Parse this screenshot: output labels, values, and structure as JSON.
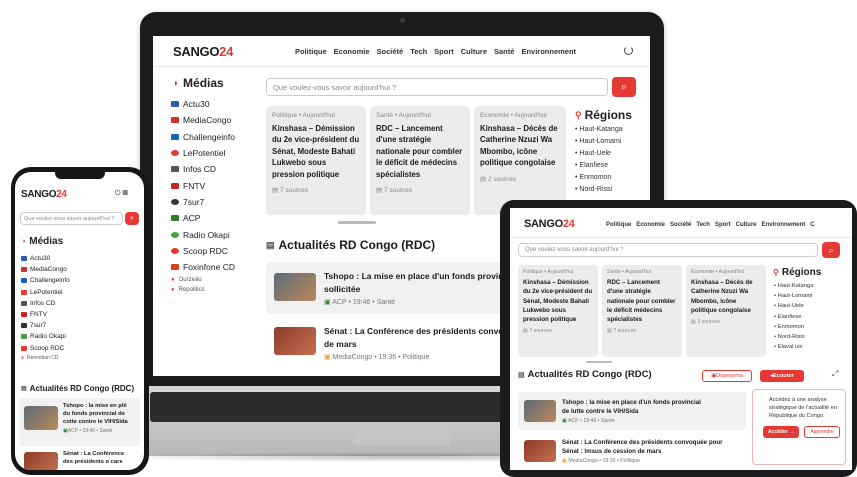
{
  "brand": {
    "name": "SANGO",
    "number": "24",
    "accent": "#e53935"
  },
  "nav": [
    "Politique",
    "Economie",
    "Société",
    "Tech",
    "Sport",
    "Culture",
    "Santé",
    "Environnement"
  ],
  "tablet_nav": [
    "Politique",
    "Economie",
    "Société",
    "Tech",
    "Sport",
    "Culture",
    "Environnement",
    "C"
  ],
  "search": {
    "placeholder": "Que voulez-vous savoir aujourd'hui ?",
    "placeholder_short": "Que voulez-vous savoir aujourd'hui ?"
  },
  "medias": {
    "title": "Médias",
    "items": [
      "Actu30",
      "MediaCongo",
      "Challengeinfo",
      "LePotentiel",
      "Infos CD",
      "FNTV",
      "7sur7",
      "ACP",
      "Radio Okapi",
      "Scoop RDC",
      "Foxinfone CD"
    ],
    "more": [
      "Ourzeäo",
      "Repolitics"
    ],
    "phone_items": [
      "Actu30",
      "MediaCongo",
      "Challengeinfo",
      "LePotentiel",
      "Infos CD",
      "FNTV",
      "7sur7",
      "Radio Okapi",
      "Scoop RDC"
    ],
    "phone_more": "Rennekan CD"
  },
  "cards": [
    {
      "tag": "Politique • Aujourd'hui",
      "title": "Kinshasa – Démission du 2e vice-président du Sénat, Modeste Bahati Lukwebo sous pression politique",
      "sources": "7 sources"
    },
    {
      "tag": "Santé • Aujourd'hui",
      "title": "RDC – Lancement d'une stratégie nationale pour combler le déficit de médecins spécialistes",
      "sources": "7 sources"
    },
    {
      "tag": "Economie • Aujourd'hui",
      "title": "Kinshasa – Décès de Catherine Nzuzi Wa Mbombo, icône politique congolaise",
      "sources": "2 sources"
    }
  ],
  "tablet_cards": [
    {
      "tag": "Politique • Aujourd'hui",
      "title": "Kinshasa – Démission du 2e vice-président du Sénat, Modeste Bahati Lukwebo sous pression politique",
      "sources": "7 sources"
    },
    {
      "tag": "Santé • Aujourd'hui",
      "title": "RDC – Lancement d'une stratégie nationale pour combler le déficit médecins spécialistes",
      "sources": "7 sources"
    },
    {
      "tag": "Economie • Aujourd'hui",
      "title": "Kinshasa – Décès de Catherine Nzuzi Wa Mbombo, icône politique congolaise",
      "sources": "3 sources"
    }
  ],
  "regions": {
    "title": "Régions",
    "items": [
      "Haut-Katanga",
      "Haut-Lomami",
      "Haut-Uele",
      "Elanfiese",
      "Enmomon",
      "Nord-Rissi"
    ],
    "tablet_items": [
      "Haut-Katanga",
      "Haut-Lomami",
      "Haut-Uele",
      "Elanfiese",
      "Enmomon",
      "Nord-Rissi",
      "Elaval ize"
    ]
  },
  "actualites": {
    "title": "Actualités RD Congo (RDC)",
    "news": [
      {
        "title": "Tshopo : La mise en place d'un fonds provincial de",
        "title2": "sollicitée",
        "source": "ACP",
        "time": "19:46",
        "category": "Santé"
      },
      {
        "title": "Sénat : La Conférence des présidents convoqué",
        "title2": "de mars",
        "source": "MediaCongo",
        "time": "19:36",
        "category": "Politique"
      }
    ],
    "tablet_news": [
      {
        "title": "Tshopo : la mise en place d'un fonds provincial",
        "title2": "de lutte contre le VIH/Sida",
        "source": "ACP",
        "time": "19:46",
        "category": "Santé"
      },
      {
        "title": "Sénat : La Conférence des présidents convoquée pour",
        "title2": "Sénat : lmsus de cession de mars",
        "source": "MediaCongo",
        "time": "19:36",
        "category": "Politique"
      }
    ],
    "phone_news": [
      {
        "title": "Tshopo : la mise en plé",
        "title2": "du fonds provincial de",
        "title3": "cotte contre le VIH/Sida",
        "source": "ACP",
        "time": "19:46",
        "category": "Santé"
      },
      {
        "title": "Sénat : La Conférence",
        "title2": "des présidents ɒ cars",
        "source": "",
        "time": "",
        "category": ""
      }
    ]
  },
  "tablet_buttons": {
    "dispense": "Dispeprma",
    "listen": "Ecouter"
  },
  "promo": {
    "text": "Accédez à une analyse stratégique de l'actualité en République du Congo.",
    "primary": "Accéder →",
    "secondary": "Apprendre"
  },
  "phone_status": {
    "time": ""
  }
}
